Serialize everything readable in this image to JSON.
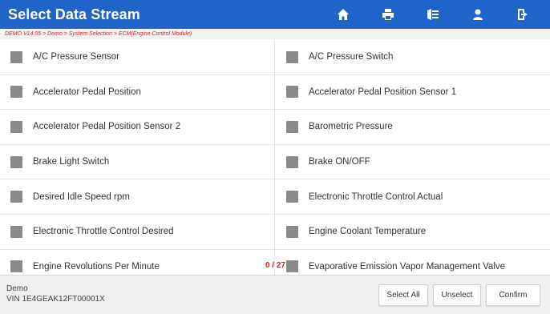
{
  "header": {
    "title": "Select Data Stream",
    "icons": [
      "home-icon",
      "print-icon",
      "feedback-icon",
      "user-icon",
      "exit-icon"
    ]
  },
  "breadcrumb": "DEMO V14.95 > Demo > System Selection > ECM(Engine Control Module)",
  "items": [
    {
      "left": "A/C Pressure Sensor",
      "right": "A/C Pressure Switch"
    },
    {
      "left": "Accelerator Pedal Position",
      "right": "Accelerator Pedal Position Sensor 1"
    },
    {
      "left": "Accelerator Pedal Position Sensor 2",
      "right": "Barometric Pressure"
    },
    {
      "left": "Brake Light Switch",
      "right": "Brake ON/OFF"
    },
    {
      "left": "Desired Idle Speed rpm",
      "right": "Electronic Throttle Control Actual"
    },
    {
      "left": "Electronic Throttle Control Desired",
      "right": "Engine Coolant Temperature"
    },
    {
      "left": "Engine Revolutions Per Minute",
      "right": "Evaporative Emission Vapor Management Valve"
    }
  ],
  "counter": "0 / 27",
  "footer": {
    "vehicle": "Demo",
    "vin": "VIN 1E4GEAK12FT00001X",
    "select_all": "Select All",
    "unselect": "Unselect",
    "confirm": "Confirm"
  },
  "colors": {
    "header_bg": "#1f64c8",
    "breadcrumb_text": "#d9261c",
    "checkbox": "#8a8a8a"
  }
}
